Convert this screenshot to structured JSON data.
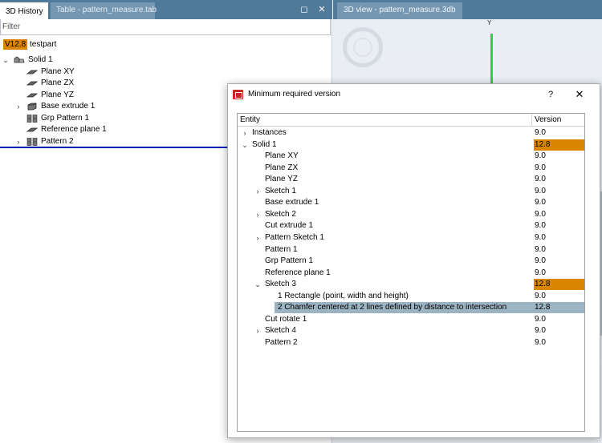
{
  "left_panel": {
    "tabs": [
      {
        "label": "3D History",
        "active": true
      },
      {
        "label": "Table - pattern_measure.tab",
        "active": false
      }
    ],
    "window_controls": {
      "restore": "◻",
      "close": "✕"
    },
    "filter_placeholder": "Filter",
    "version_badge": "V12.8",
    "part_name": "testpart",
    "tree": [
      {
        "label": "Solid 1",
        "icon": "solid-icon",
        "expand": "expanded"
      },
      {
        "label": "Plane XY",
        "icon": "plane-icon"
      },
      {
        "label": "Plane ZX",
        "icon": "plane-icon"
      },
      {
        "label": "Plane YZ",
        "icon": "plane-icon"
      },
      {
        "label": "Base extrude 1",
        "icon": "extrude-icon",
        "expand": "collapsed"
      },
      {
        "label": "Grp Pattern 1",
        "icon": "pattern-icon"
      },
      {
        "label": "Reference plane 1",
        "icon": "plane-icon"
      },
      {
        "label": "Pattern 2",
        "icon": "pattern-icon",
        "expand": "collapsed"
      }
    ]
  },
  "right_panel": {
    "tab_label": "3D view - pattern_measure.3db",
    "axis_label": "Y"
  },
  "dialog": {
    "title": "Minimum required version",
    "help": "?",
    "close": "✕",
    "columns": {
      "entity": "Entity",
      "version": "Version"
    },
    "rows": [
      {
        "label": "Instances",
        "version": "9.0",
        "expand": "collapsed"
      },
      {
        "label": "Solid 1",
        "version": "12.8",
        "expand": "expanded",
        "highlight": true
      },
      {
        "label": "Plane XY",
        "version": "9.0"
      },
      {
        "label": "Plane ZX",
        "version": "9.0"
      },
      {
        "label": "Plane YZ",
        "version": "9.0"
      },
      {
        "label": "Sketch 1",
        "version": "9.0",
        "expand": "collapsed"
      },
      {
        "label": "Base extrude 1",
        "version": "9.0"
      },
      {
        "label": "Sketch 2",
        "version": "9.0",
        "expand": "collapsed"
      },
      {
        "label": "Cut extrude 1",
        "version": "9.0"
      },
      {
        "label": "Pattern Sketch 1",
        "version": "9.0",
        "expand": "collapsed"
      },
      {
        "label": "Pattern 1",
        "version": "9.0"
      },
      {
        "label": "Grp Pattern 1",
        "version": "9.0"
      },
      {
        "label": "Reference plane 1",
        "version": "9.0"
      },
      {
        "label": "Sketch 3",
        "version": "12.8",
        "expand": "expanded",
        "highlight": true
      },
      {
        "label": "1   Rectangle (point, width and height)",
        "version": "9.0"
      },
      {
        "label": "2   Chamfer centered at 2 lines defined by distance to intersection",
        "version": "12.8",
        "selected": true
      },
      {
        "label": "Cut rotate 1",
        "version": "9.0"
      },
      {
        "label": "Sketch 4",
        "version": "9.0",
        "expand": "collapsed"
      },
      {
        "label": "Pattern 2",
        "version": "9.0"
      }
    ]
  },
  "colors": {
    "tab_bar": "#4f7a99",
    "highlight_orange": "#d98500",
    "selection_blue": "#9bb3c3",
    "drop_indicator": "#0a1fb5",
    "y_axis_green": "#2fd13e"
  }
}
